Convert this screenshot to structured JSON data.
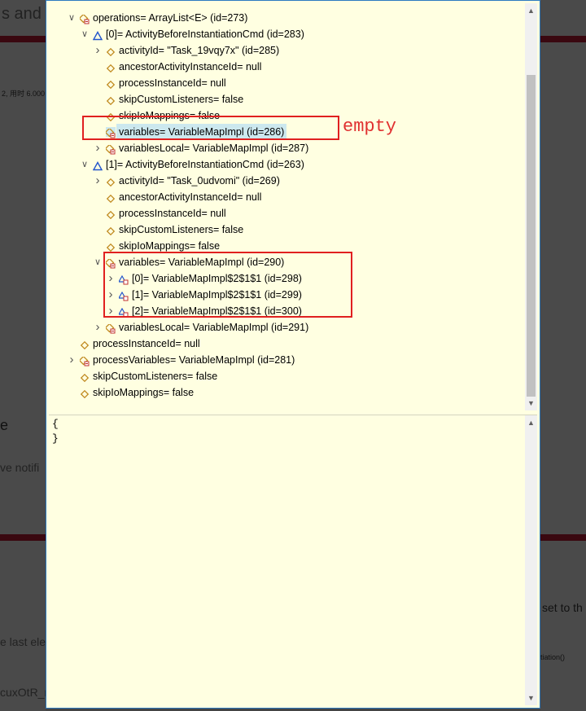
{
  "background": {
    "fragments": [
      "s and",
      "2, 用时 6.000",
      "e",
      "ve notifi",
      "e last ele",
      "cuxOtR_r",
      "set to th",
      "tiation()"
    ]
  },
  "tree": [
    {
      "indent": 0,
      "twisty": "open",
      "icon": "field-icon",
      "label": "operations= ArrayList<E>  (id=273)"
    },
    {
      "indent": 1,
      "twisty": "open",
      "icon": "triangle-icon",
      "label": "[0]= ActivityBeforeInstantiationCmd  (id=283)"
    },
    {
      "indent": 2,
      "twisty": "closed",
      "icon": "diamond-icon",
      "label": "activityId= \"Task_19vqy7x\" (id=285)"
    },
    {
      "indent": 2,
      "twisty": "none",
      "icon": "diamond-icon",
      "label": "ancestorActivityInstanceId= null"
    },
    {
      "indent": 2,
      "twisty": "none",
      "icon": "diamond-icon",
      "label": "processInstanceId= null"
    },
    {
      "indent": 2,
      "twisty": "none",
      "icon": "diamond-icon",
      "label": "skipCustomListeners= false"
    },
    {
      "indent": 2,
      "twisty": "none",
      "icon": "diamond-icon",
      "label": "skipIoMappings= false"
    },
    {
      "indent": 2,
      "twisty": "none",
      "icon": "field-icon",
      "label": "variables= VariableMapImpl  (id=286)",
      "selected": true
    },
    {
      "indent": 2,
      "twisty": "closed",
      "icon": "field-icon",
      "label": "variablesLocal= VariableMapImpl  (id=287)"
    },
    {
      "indent": 1,
      "twisty": "open",
      "icon": "triangle-icon",
      "label": "[1]= ActivityBeforeInstantiationCmd  (id=263)"
    },
    {
      "indent": 2,
      "twisty": "closed",
      "icon": "diamond-icon",
      "label": "activityId= \"Task_0udvomi\" (id=269)"
    },
    {
      "indent": 2,
      "twisty": "none",
      "icon": "diamond-icon",
      "label": "ancestorActivityInstanceId= null"
    },
    {
      "indent": 2,
      "twisty": "none",
      "icon": "diamond-icon",
      "label": "processInstanceId= null"
    },
    {
      "indent": 2,
      "twisty": "none",
      "icon": "diamond-icon",
      "label": "skipCustomListeners= false"
    },
    {
      "indent": 2,
      "twisty": "none",
      "icon": "diamond-icon",
      "label": "skipIoMappings= false"
    },
    {
      "indent": 2,
      "twisty": "open",
      "icon": "field-icon",
      "label": "variables= VariableMapImpl  (id=290)"
    },
    {
      "indent": 3,
      "twisty": "closed",
      "icon": "entry-icon",
      "label": "[0]= VariableMapImpl$2$1$1  (id=298)"
    },
    {
      "indent": 3,
      "twisty": "closed",
      "icon": "entry-icon",
      "label": "[1]= VariableMapImpl$2$1$1  (id=299)"
    },
    {
      "indent": 3,
      "twisty": "closed",
      "icon": "entry-icon",
      "label": "[2]= VariableMapImpl$2$1$1  (id=300)"
    },
    {
      "indent": 2,
      "twisty": "closed",
      "icon": "field-icon",
      "label": "variablesLocal= VariableMapImpl  (id=291)"
    },
    {
      "indent": 0,
      "twisty": "none",
      "icon": "diamond-icon",
      "label": "processInstanceId= null"
    },
    {
      "indent": 0,
      "twisty": "closed",
      "icon": "field-icon",
      "label": "processVariables= VariableMapImpl  (id=281)"
    },
    {
      "indent": 0,
      "twisty": "none",
      "icon": "diamond-icon",
      "label": "skipCustomListeners= false"
    },
    {
      "indent": 0,
      "twisty": "none",
      "icon": "diamond-icon",
      "label": "skipIoMappings= false"
    }
  ],
  "detail": {
    "text": "{\n}"
  },
  "annotation": {
    "text": "empty"
  },
  "colors": {
    "popup_bg": "#ffffe1",
    "highlight": "#e02020",
    "selection": "#cce8ee",
    "field_icon": "#c08a20",
    "triangle_icon": "#2255cc"
  }
}
